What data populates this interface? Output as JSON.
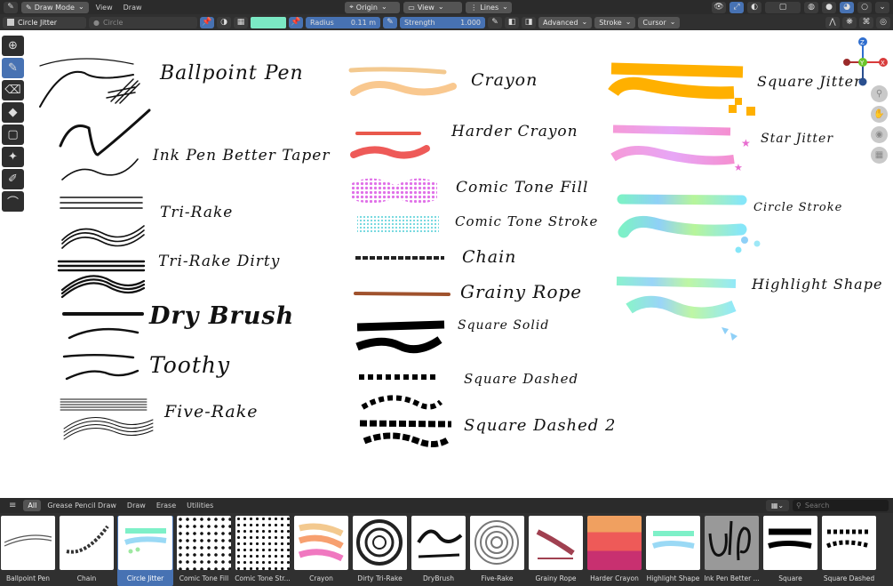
{
  "header": {
    "editor_icon": "grease-pencil-icon",
    "mode": "Draw Mode",
    "menus": [
      "View",
      "Draw"
    ],
    "origin": "Origin",
    "view": "View",
    "lines": "Lines"
  },
  "toolbar": {
    "brush": "Circle Jitter",
    "material": "Circle",
    "radius_label": "Radius",
    "radius_value": "0.11 m",
    "strength_label": "Strength",
    "strength_value": "1.000",
    "advanced": "Advanced",
    "stroke": "Stroke",
    "cursor": "Cursor",
    "swatch_color": "#7be8c4"
  },
  "gizmo": {
    "z": "Z",
    "y": "Y",
    "x": "X",
    "nx": "X"
  },
  "labels": {
    "ballpoint": "Ballpoint Pen",
    "ink": "Ink Pen Better Taper",
    "trirake": "Tri-Rake",
    "trirake_dirty": "Tri-Rake Dirty",
    "drybrush": "Dry Brush",
    "toothy": "Toothy",
    "fiverake": "Five-Rake",
    "crayon": "Crayon",
    "harder_crayon": "Harder Crayon",
    "comic_fill": "Comic Tone Fill",
    "comic_stroke": "Comic Tone Stroke",
    "chain": "Chain",
    "grainy": "Grainy Rope",
    "sq_solid": "Square Solid",
    "sq_dashed": "Square Dashed",
    "sq_dashed2": "Square Dashed 2",
    "sq_jitter": "Square Jitter",
    "star_jitter": "Star Jitter",
    "circle_stroke": "Circle Stroke",
    "highlight": "Highlight Shape"
  },
  "asset_bar": {
    "categories": [
      "All",
      "Grease Pencil Draw",
      "Draw",
      "Erase",
      "Utilities"
    ],
    "active_category": "All",
    "search_placeholder": "Search",
    "assets": [
      "Ballpoint Pen",
      "Chain",
      "Circle Jitter",
      "Comic Tone Fill",
      "Comic Tone Str...",
      "Crayon",
      "Dirty Tri-Rake",
      "DryBrush",
      "Five-Rake",
      "Grainy Rope",
      "Harder Crayon",
      "Highlight Shape",
      "Ink Pen Better ...",
      "Square",
      "Square Dashed"
    ],
    "selected": "Circle Jitter"
  }
}
